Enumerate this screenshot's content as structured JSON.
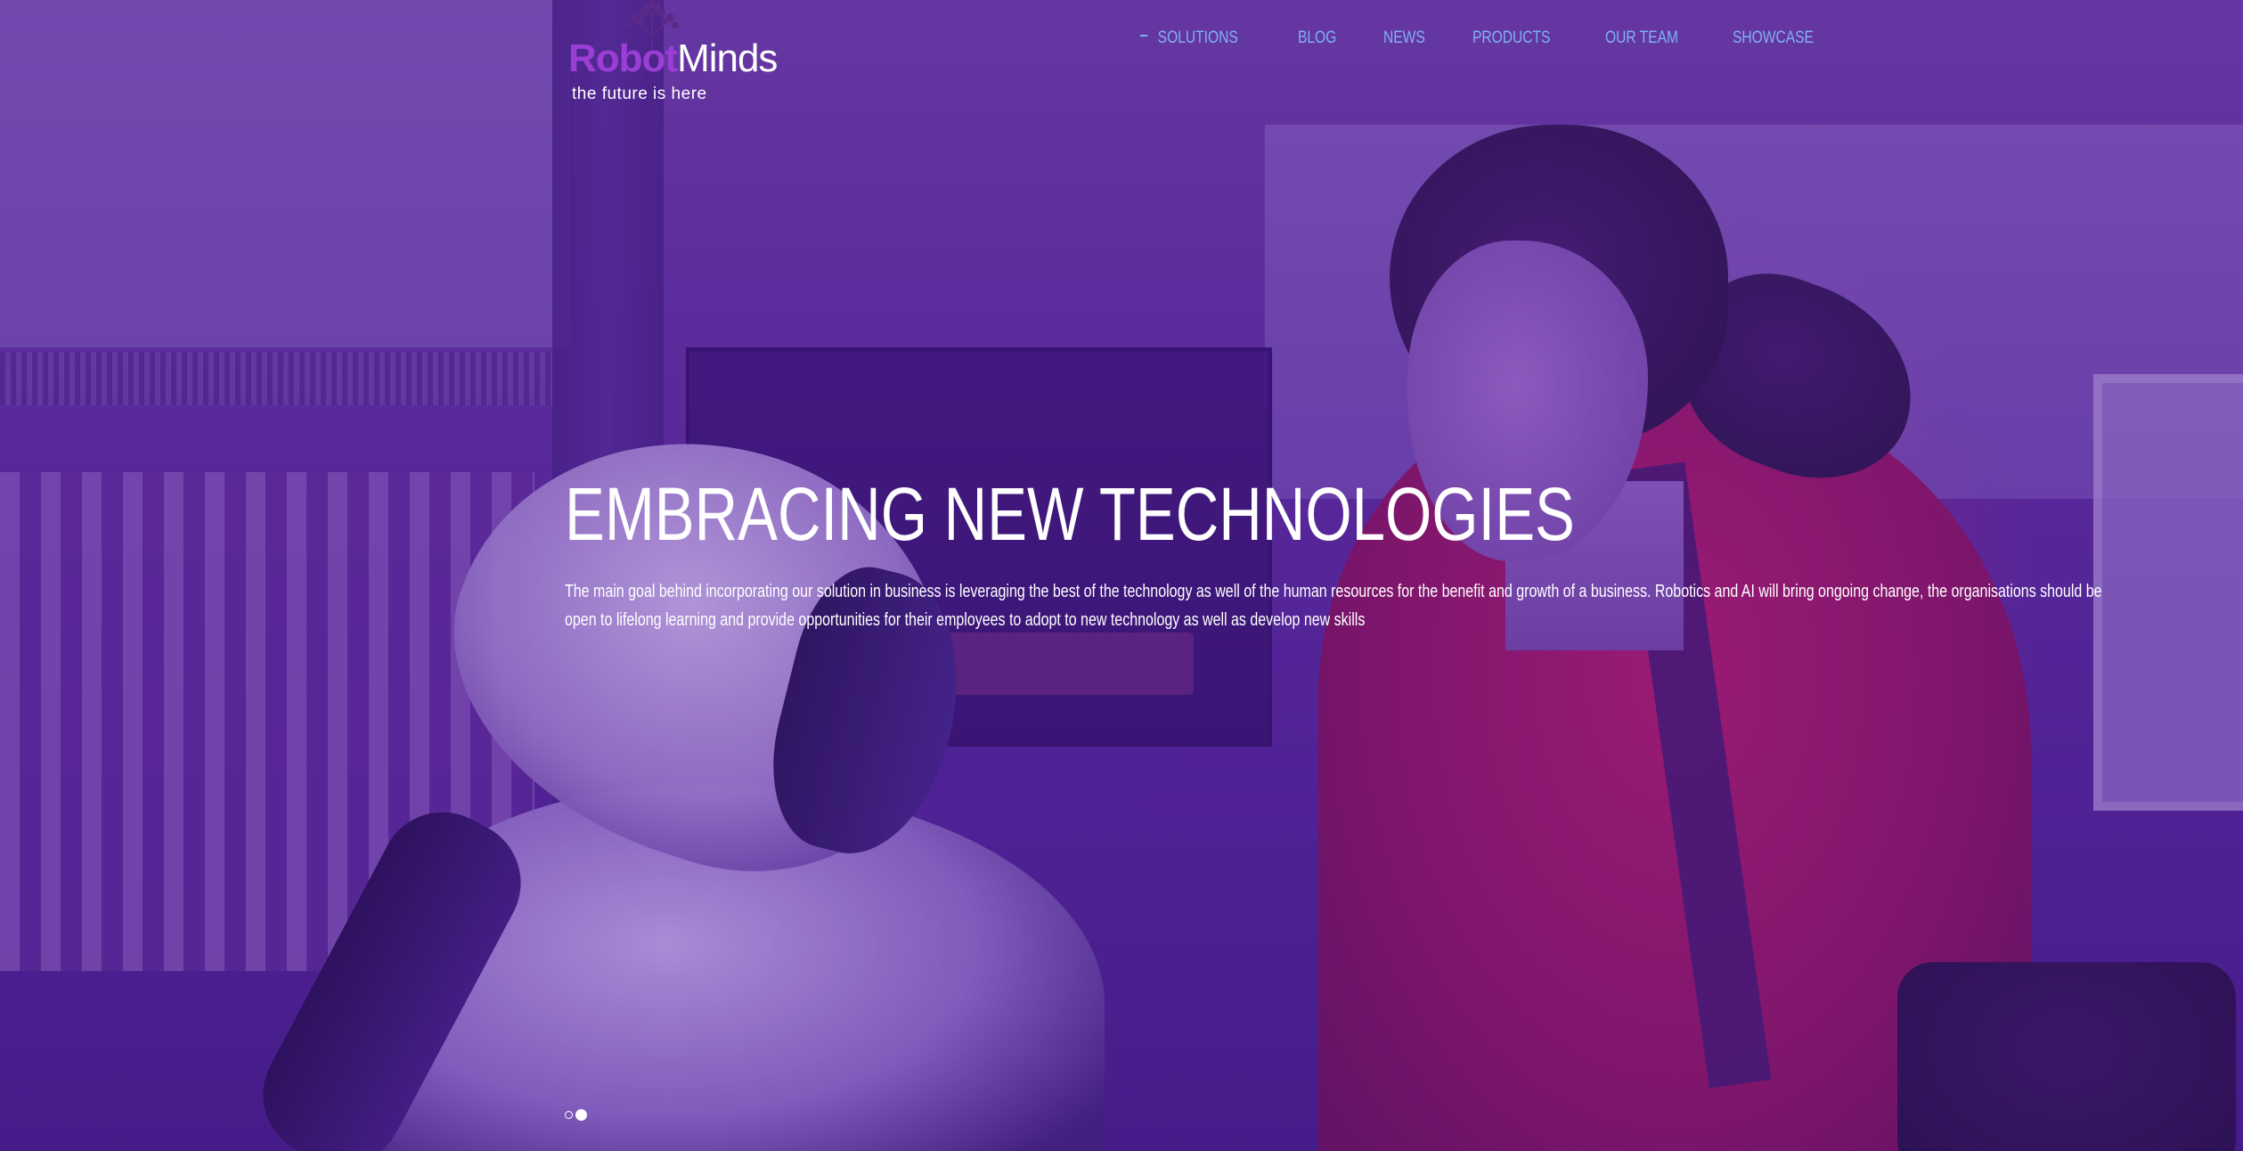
{
  "logo": {
    "word_1": "Robot",
    "word_2": "Minds",
    "tagline": "the future is here",
    "icon": "tree-icon"
  },
  "nav": {
    "items": [
      {
        "label": "SOLUTIONS",
        "active": true
      },
      {
        "label": "BLOG"
      },
      {
        "label": "NEWS"
      },
      {
        "label": "PRODUCTS"
      },
      {
        "label": "OUR TEAM"
      },
      {
        "label": "SHOWCASE"
      }
    ]
  },
  "hero": {
    "title": "EMBRACING NEW TECHNOLOGIES",
    "text": "The main goal behind incorporating our solution in business is leveraging the best of the technology as well of the human resources for the benefit and growth of a business. Robotics and AI will bring ongoing change, the organisations should be open to lifelong learning and provide opportunities for their employees to adopt to new technology as well as develop new skills"
  },
  "slider": {
    "slide_count": 2,
    "active_slide": 2
  },
  "colors": {
    "overlay": "#5824a0",
    "nav_link": "#7fb2f0",
    "logo_accent": "#9b3ed6",
    "text": "#ffffff"
  }
}
